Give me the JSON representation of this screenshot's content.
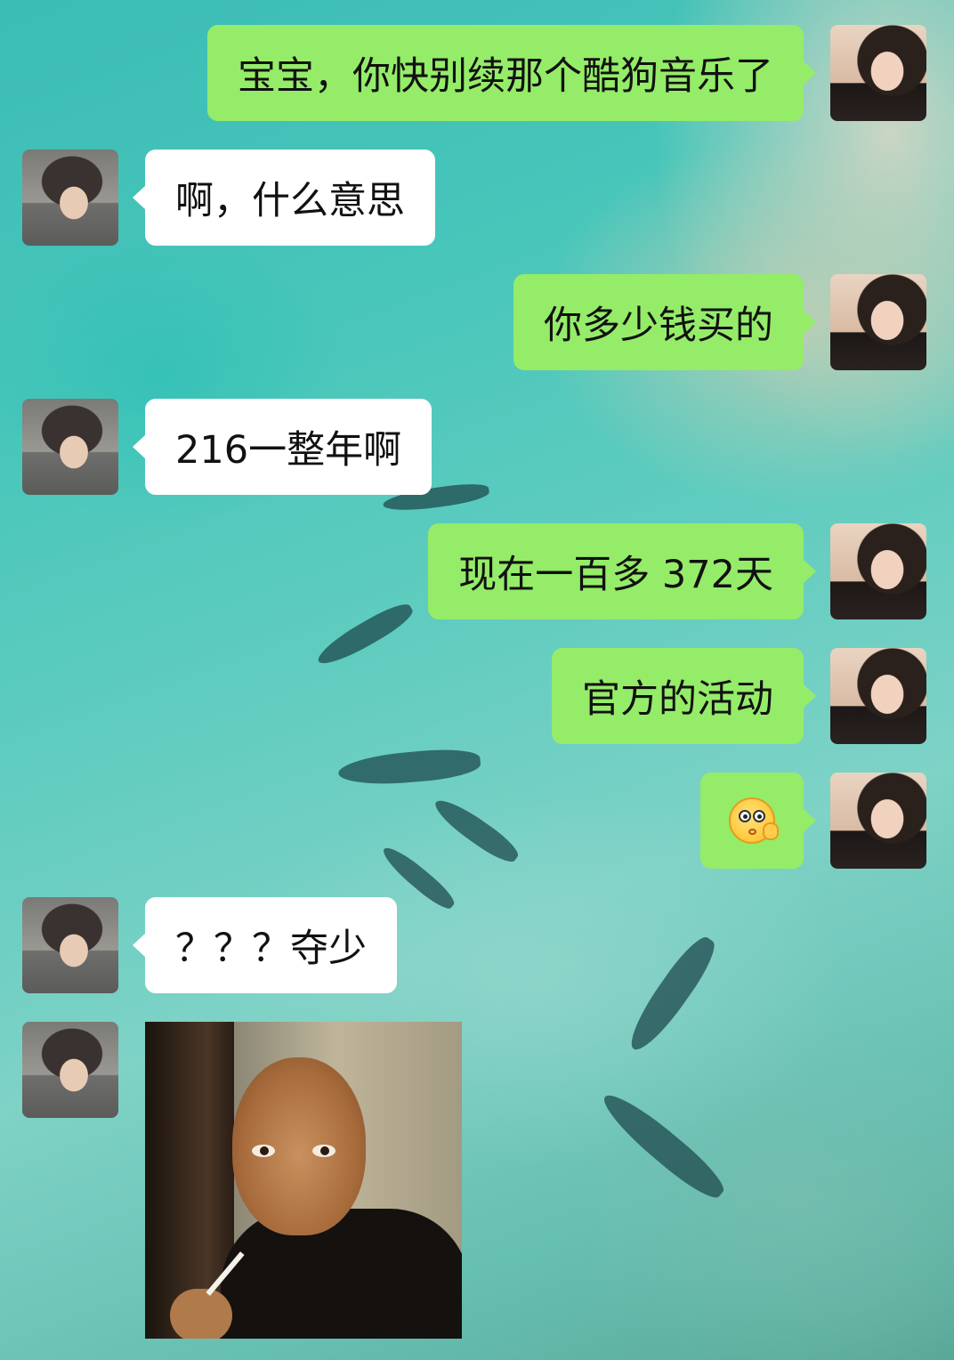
{
  "messages": [
    {
      "side": "right",
      "text": "宝宝，你快别续那个酷狗音乐了"
    },
    {
      "side": "left",
      "text": "啊，什么意思"
    },
    {
      "side": "right",
      "text": "你多少钱买的"
    },
    {
      "side": "left",
      "text": "216一整年啊"
    },
    {
      "side": "right",
      "text": "现在一百多 372天"
    },
    {
      "side": "right",
      "text": "官方的活动"
    },
    {
      "side": "right",
      "emoji": "peeking-face-emoji"
    },
    {
      "side": "left",
      "text": "？？？夺少"
    },
    {
      "side": "left",
      "sticker": "man-smoking-sticker"
    }
  ],
  "colors": {
    "sent_bubble": "#95ec69",
    "received_bubble": "#ffffff"
  }
}
